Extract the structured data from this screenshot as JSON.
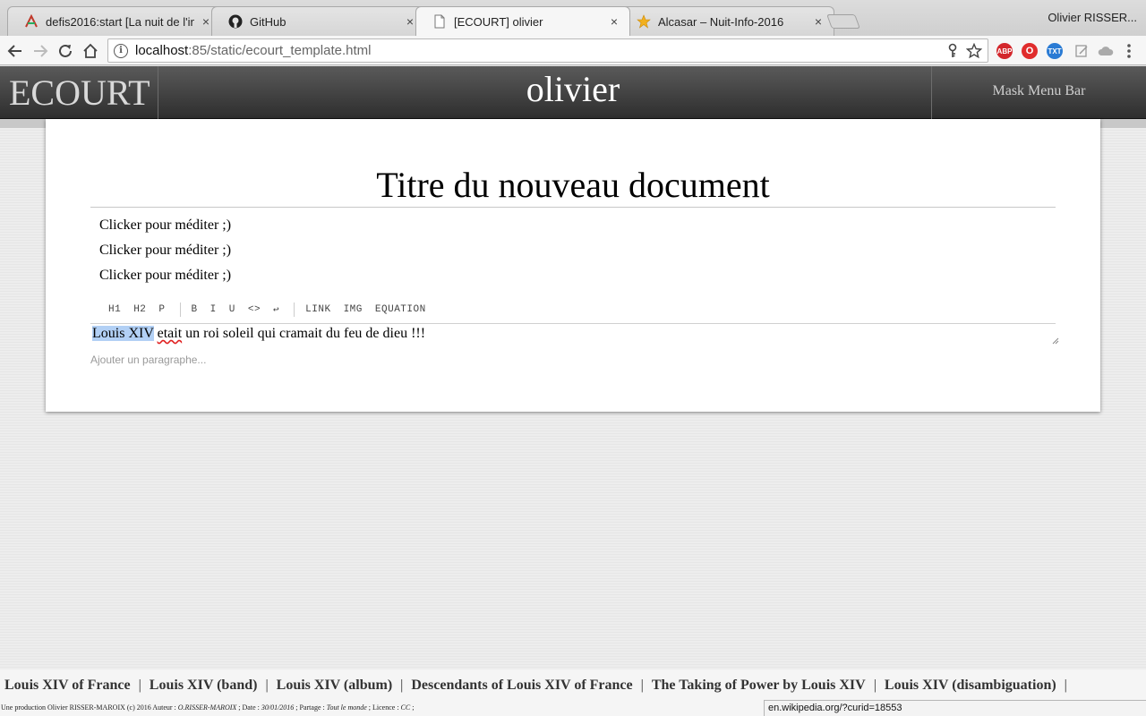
{
  "browser": {
    "tabs": [
      {
        "title": "defis2016:start [La nuit de l'in",
        "close": "×",
        "favicon": "wiki-icon"
      },
      {
        "title": "GitHub",
        "close": "×",
        "favicon": "github-icon"
      },
      {
        "title": "[ECOURT] olivier",
        "close": "×",
        "favicon": "page-icon"
      },
      {
        "title": "Alcasar – Nuit-Info-2016",
        "close": "×",
        "favicon": "star-icon"
      }
    ],
    "profile_name": "Olivier RISSER...",
    "url_host": "localhost",
    "url_rest": ":85/static/ecourt_template.html",
    "extensions": [
      {
        "label": "ABP",
        "color": "#d3262b"
      },
      {
        "label": "O",
        "color": "#e02c2c"
      },
      {
        "label": "TXT",
        "color": "#2a7bd4"
      }
    ]
  },
  "app": {
    "brand": "ECOURT",
    "username": "olivier",
    "mask_menu": "Mask Menu Bar"
  },
  "document": {
    "title": "Titre du nouveau document",
    "paragraphs": [
      "Clicker pour méditer ;)",
      "Clicker pour méditer ;)",
      "Clicker pour méditer ;)"
    ],
    "format_toolbar": {
      "h1": "H1",
      "h2": "H2",
      "p": "P",
      "bold": "B",
      "italic": "I",
      "underline": "U",
      "code": "<>",
      "newline": "↩",
      "link": "LINK",
      "img": "IMG",
      "equation": "EQUATION"
    },
    "editor": {
      "selected": "Louis XIV",
      "misspelled": "etait",
      "rest": " un roi soleil qui cramait du feu de dieu !!!"
    },
    "add_paragraph": "Ajouter un paragraphe..."
  },
  "footer": {
    "related_links": [
      "Louis XIV of France",
      "Louis XIV (band)",
      "Louis XIV (album)",
      "Descendants of Louis XIV of France",
      "The Taking of Power by Louis XIV",
      "Louis XIV (disambiguation)"
    ],
    "pipe": "|",
    "credits": {
      "prefix": "Une production Olivier RISSER-MAROIX (c) 2016 Auteur : ",
      "author": "O.RISSER-MAROIX",
      "date_label": " ; Date : ",
      "date": "30/01/2016",
      "share_label": " ; Partage : ",
      "share": "Tout le monde",
      "licence_label": " ; Licence : ",
      "licence": "CC",
      "end": " ;"
    },
    "status_url": "en.wikipedia.org/?curid=18553"
  }
}
